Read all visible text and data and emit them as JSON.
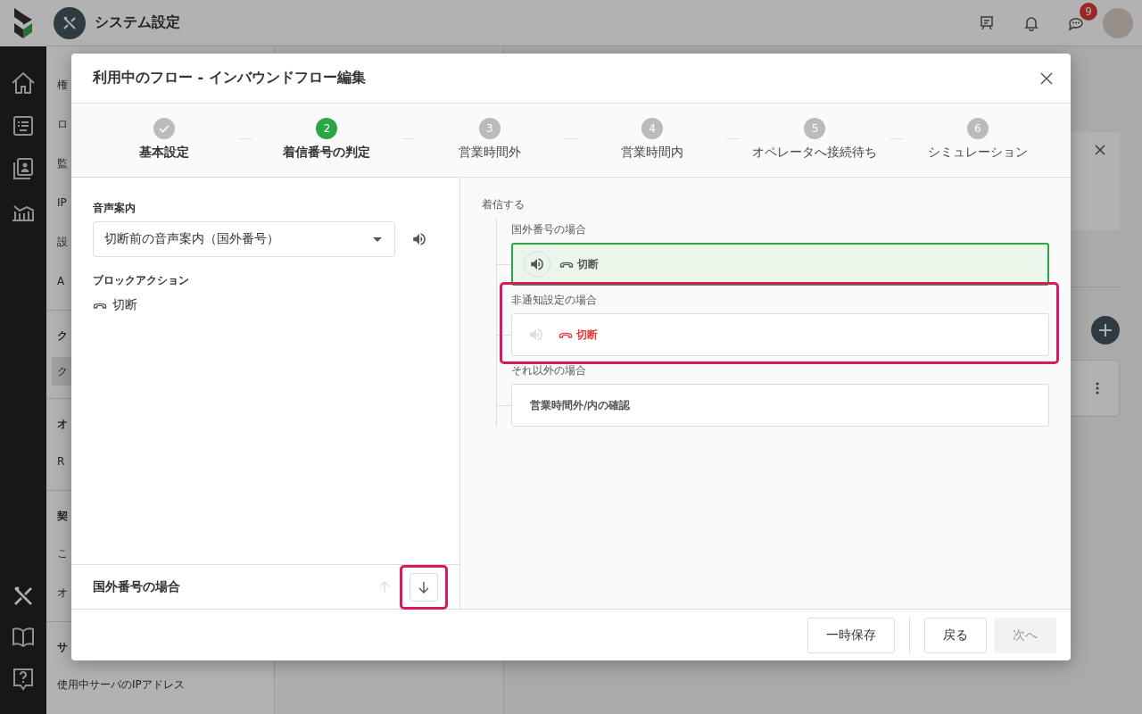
{
  "topbar": {
    "title": "システム設定",
    "chat_badge": "9"
  },
  "settings_nav": [
    {
      "kind": "item",
      "label": "権",
      "selected": false
    },
    {
      "kind": "item",
      "label": "ロ",
      "selected": false
    },
    {
      "kind": "item",
      "label": "監",
      "selected": false
    },
    {
      "kind": "item",
      "label": "IP",
      "selected": false
    },
    {
      "kind": "item",
      "label": "設",
      "selected": false
    },
    {
      "kind": "item",
      "label": "A",
      "selected": false
    },
    {
      "kind": "heading",
      "label": "ク"
    },
    {
      "kind": "item",
      "label": "ク",
      "selected": true
    },
    {
      "kind": "heading",
      "label": "オ"
    },
    {
      "kind": "item",
      "label": "R",
      "selected": false
    },
    {
      "kind": "heading",
      "label": "契"
    },
    {
      "kind": "item",
      "label": "こ",
      "selected": false
    },
    {
      "kind": "item",
      "label": "オ",
      "selected": false
    },
    {
      "kind": "heading",
      "label": "サ"
    },
    {
      "kind": "item",
      "label": "使用中サーバのIPアドレス",
      "selected": false
    }
  ],
  "dialog": {
    "title": "利用中のフロー - インバウンドフロー編集",
    "steps": [
      {
        "label": "基本設定",
        "completed": true,
        "selected": false
      },
      {
        "number": "2",
        "label": "着信番号の判定",
        "completed": false,
        "selected": true
      },
      {
        "number": "3",
        "label": "営業時間外",
        "completed": false,
        "selected": false
      },
      {
        "number": "4",
        "label": "営業時間内",
        "completed": false,
        "selected": false
      },
      {
        "number": "5",
        "label": "オペレータへ接続待ち",
        "completed": false,
        "selected": false
      },
      {
        "number": "6",
        "label": "シミュレーション",
        "completed": false,
        "selected": false
      }
    ],
    "editor": {
      "voice_label": "音声案内",
      "voice_value": "切断前の音声案内（国外番号）",
      "action_label": "ブロックアクション",
      "action_value": "切断"
    },
    "selected_branch": {
      "label": "国外番号の場合",
      "up_disabled": true,
      "down_disabled": false,
      "down_highlighted": true
    },
    "tree": {
      "root": "着信する",
      "branches": [
        {
          "label": "国外番号の場合",
          "kind": "action",
          "selected": true,
          "sound": true,
          "action": "切断",
          "warning": false
        },
        {
          "label": "非通知設定の場合",
          "kind": "action",
          "selected": false,
          "sound": false,
          "action": "切断",
          "warning": true,
          "highlighted": true
        },
        {
          "label": "それ以外の場合",
          "kind": "next",
          "selected": false,
          "text": "営業時間外/内の確認"
        }
      ]
    },
    "buttons": [
      {
        "label": "一時保存",
        "disabled": false
      },
      {
        "label": "戻る",
        "disabled": false
      },
      {
        "label": "次へ",
        "disabled": true
      }
    ]
  }
}
